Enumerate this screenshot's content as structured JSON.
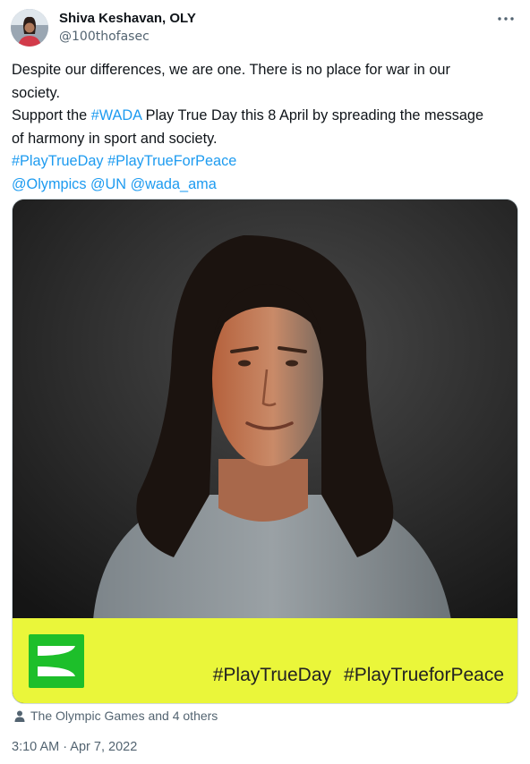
{
  "author": {
    "name": "Shiva Keshavan, OLY",
    "handle": "@100thofasec"
  },
  "tweet": {
    "lines": [
      [
        {
          "t": "Despite our differences, we are one. There is no place for war in our",
          "link": false
        }
      ],
      [
        {
          "t": "society.",
          "link": false
        }
      ],
      [
        {
          "t": "Support the ",
          "link": false
        },
        {
          "t": "#WADA",
          "link": true
        },
        {
          "t": " Play True Day this 8 April by spreading the message",
          "link": false
        }
      ],
      [
        {
          "t": "of harmony in sport and society.",
          "link": false
        }
      ],
      [
        {
          "t": "#PlayTrueDay",
          "link": true
        },
        {
          "t": " ",
          "link": false
        },
        {
          "t": "#PlayTrueForPeace",
          "link": true
        }
      ],
      [
        {
          "t": "@Olympics",
          "link": true
        },
        {
          "t": " ",
          "link": false
        },
        {
          "t": "@UN",
          "link": true
        },
        {
          "t": " ",
          "link": false
        },
        {
          "t": "@wada_ama",
          "link": true
        }
      ]
    ]
  },
  "media": {
    "overlay_tags": [
      "#PlayTrueDay",
      "#PlayTrueforPeace"
    ],
    "banner_color": "#eaf63a",
    "logo_color": "#1dbf2a"
  },
  "tagged": {
    "icon": "person-icon",
    "text": "The Olympic Games and 4 others"
  },
  "timestamp": "3:10 AM · Apr 7, 2022",
  "colors": {
    "link": "#1d9bf0",
    "secondary": "#536471",
    "primary": "#0f1419"
  }
}
